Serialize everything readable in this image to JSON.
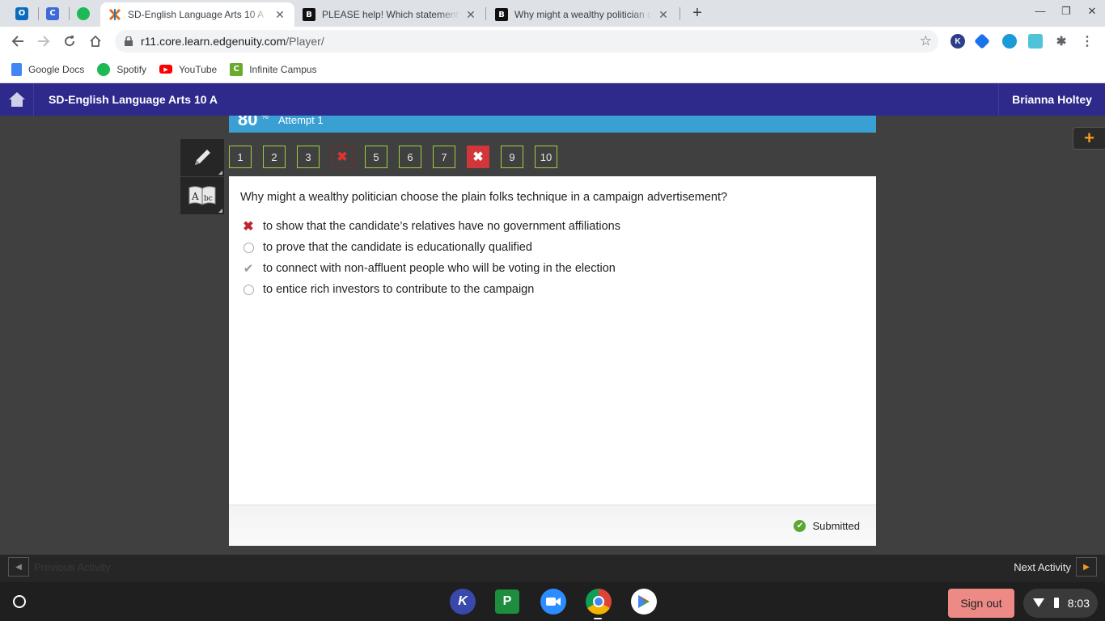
{
  "browser": {
    "tabs": [
      {
        "title": "SD-English Language Arts 10 A - ",
        "active": true,
        "favicon": "edgenuity-icon"
      },
      {
        "title": "PLEASE help! Which statements",
        "active": false,
        "favicon": "brainly-icon"
      },
      {
        "title": "Why might a wealthy politician c",
        "active": false,
        "favicon": "brainly-icon"
      }
    ],
    "pinned_tabs": [
      {
        "icon": "outlook-icon",
        "letter": "O",
        "color": "#0a6cbf"
      },
      {
        "icon": "classlink-icon",
        "letter": "C",
        "color": "#3d69d9"
      },
      {
        "icon": "spotify-icon",
        "letter": "",
        "color": "#1db954"
      }
    ],
    "url_host": "r11.core.learn.edgenuity.com",
    "url_path": "/Player/",
    "bookmarks": [
      {
        "label": "Google Docs",
        "icon": "google-docs-icon",
        "color": "#4285f4"
      },
      {
        "label": "Spotify",
        "icon": "spotify-icon",
        "color": "#1db954"
      },
      {
        "label": "YouTube",
        "icon": "youtube-icon",
        "color": "#ff0000"
      },
      {
        "label": "Infinite Campus",
        "icon": "infinite-campus-icon",
        "color": "#6aaa2e"
      }
    ]
  },
  "app": {
    "course_title": "SD-English Language Arts 10 A",
    "user_name": "Brianna Holtey",
    "score": "80",
    "score_unit": "%",
    "attempt": "Attempt 1",
    "question_numbers": [
      {
        "label": "1",
        "state": "normal"
      },
      {
        "label": "2",
        "state": "normal"
      },
      {
        "label": "3",
        "state": "normal"
      },
      {
        "label": "✖",
        "state": "wrong"
      },
      {
        "label": "5",
        "state": "normal"
      },
      {
        "label": "6",
        "state": "normal"
      },
      {
        "label": "7",
        "state": "normal"
      },
      {
        "label": "✖",
        "state": "current"
      },
      {
        "label": "9",
        "state": "normal"
      },
      {
        "label": "10",
        "state": "normal"
      }
    ],
    "question": "Why might a wealthy politician choose the plain folks technique in a campaign advertisement?",
    "answers": [
      {
        "text": "to show that the candidate’s relatives have no government affiliations",
        "mark": "wrong"
      },
      {
        "text": "to prove that the candidate is educationally qualified",
        "mark": "radio"
      },
      {
        "text": "to connect with non-affluent people who will be voting in the election",
        "mark": "correct"
      },
      {
        "text": "to entice rich investors to contribute to the campaign",
        "mark": "radio"
      }
    ],
    "status": "Submitted",
    "prev_activity": "Previous Activity",
    "next_activity": "Next Activity"
  },
  "shelf": {
    "apps": [
      {
        "icon": "kami-icon",
        "letter": "K",
        "color": "#3949ab"
      },
      {
        "icon": "google-classroom-icon",
        "letter": "P",
        "color": "#1e8e3e"
      },
      {
        "icon": "zoom-icon",
        "letter": "",
        "color": "#2d8cff"
      },
      {
        "icon": "chrome-icon",
        "letter": "",
        "color": "#db4437"
      },
      {
        "icon": "play-store-icon",
        "letter": "",
        "color": "#ffffff"
      }
    ],
    "sign_out": "Sign out",
    "time": "8:03"
  },
  "colors": {
    "header": "#2e2a8c",
    "score_bar": "#3aa0d4",
    "wrong": "#c0272d",
    "nav_border": "#9fcf3f",
    "accent": "#f39a1e"
  }
}
